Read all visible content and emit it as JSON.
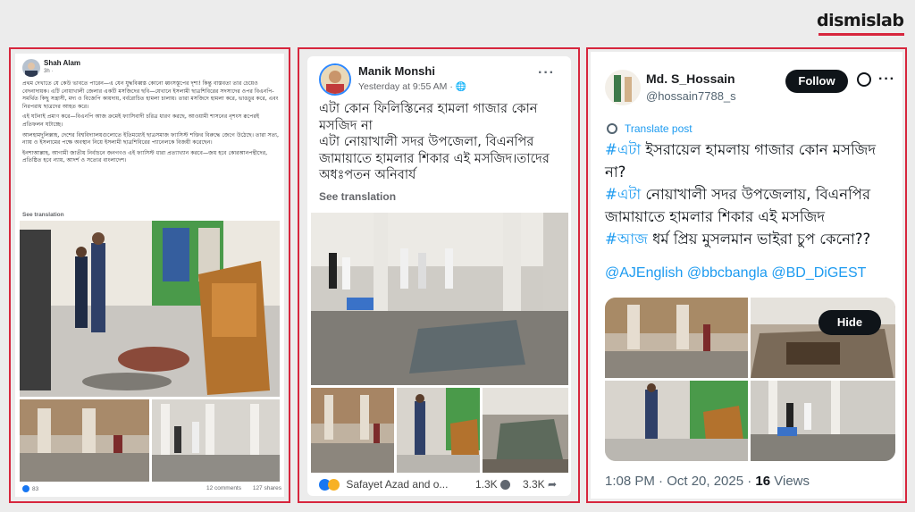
{
  "brand": {
    "logo_text": "dismislab",
    "accent_color": "#d7263d"
  },
  "panel1": {
    "author": "Shah Alam",
    "time": "3h ·",
    "paragraphs": [
      "প্রথম দেখাতে যে কেউ ভাবতে পারেন—এ যেন যুদ্ধবিধ্বস্ত কোনো ধ্বংসস্তূপের দৃশ্য! কিন্তু বাস্তবতা তার চেয়েও বেদনাদায়ক। এটি নোয়াখালী জেলার একটি মসজিদের ছবি—যেখানে ইসলামী ছাত্রশিবিরের সদস্যদের ওপর বিএনপি-সমর্থিত কিছু সন্ত্রাসী, মদ্য ও বিজেপি কায়দায়, বর্বরোচিত হামলা চালায়। তারা মসজিদে হামলা করে, ভাঙচুর করে, এবং নিরপরাধ ছাত্রদের আহত করে।",
      "এই ঘটনাই প্রমাণ করে—বিএনপি আজ ক্রমেই ফ্যাসিবাদী চরিত্র ধারণ করছে, আওয়ামী শাসনের নৃশংস রূপেরই প্রতিফলন ঘটাচ্ছে।",
      "আলহামদুলিল্লাহ, দেশের বিশ্ববিদ্যালয়গুলোতে ইতিমধ্যেই ছাত্রসমাজ ফ্যাসিস্ট শক্তির বিরুদ্ধে জেগে উঠেছে। তারা সত্য, ন্যায় ও ইসলামের পক্ষে অবস্থান নিয়ে ইসলামী ছাত্রশিবিরের প্যানেলকে বিজয়ী করেছেন।",
      "ইনশাআল্লাহ, আগামী জাতীয় নির্বাচনে জনগণও এই ফ্যাসিস্ট ধারা প্রত্যাখ্যান করবে—জয় হবে কোরআনপন্থীদের, প্রতিষ্ঠিত হবে ন্যায়, আদর্শ ও সত্যের বাংলাদেশ।"
    ],
    "see_translation": "See translation",
    "reactions_count": "83",
    "comments": "12 comments",
    "shares": "127 shares"
  },
  "panel2": {
    "author": "Manik Monshi",
    "time": "Yesterday at 9:55 AM ·",
    "more": "···",
    "text": "এটা কোন ফিলিস্তিনের হামলা গাজার কোন মসজিদ না\nএটা নোয়াখালী সদর উপজেলা, বিএনপির জামায়াতে হামলার শিকার এই মসজিদ।তাদের অধঃপতন অনিবার্য",
    "see_translation": "See translation",
    "reactors": "Safayet Azad and o...",
    "comments": "1.3K",
    "shares": "3.3K"
  },
  "panel3": {
    "author": "Md. S_Hossain",
    "handle": "@hossain7788_s",
    "follow_label": "Follow",
    "more": "···",
    "translate_label": "Translate post",
    "lines": [
      {
        "tag": "#এটা",
        "text": " ইসরায়েল হামলায় গাজার কোন মসজিদ না?"
      },
      {
        "tag": "#এটা",
        "text": " নোয়াখালী সদর উপজেলায়, বিএনপির জামায়াতে হামলার শিকার এই মসজিদ"
      },
      {
        "tag": "#আজ",
        "text": " ধর্ম প্রিয় মুসলমান ভাইরা চুপ কেনো??"
      }
    ],
    "mentions": "@AJEnglish @bbcbangla @BD_DiGEST",
    "hide_label": "Hide",
    "timestamp": "1:08 PM · Oct 20, 2025 · ",
    "views_count": "16",
    "views_label": " Views"
  }
}
